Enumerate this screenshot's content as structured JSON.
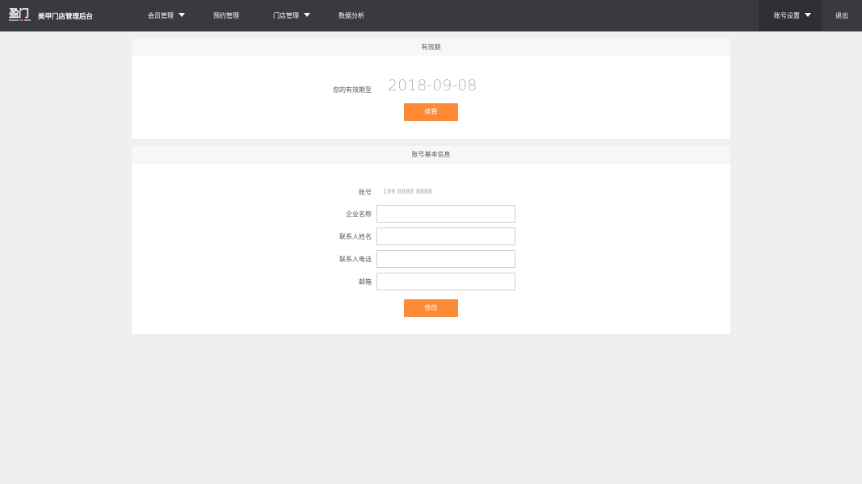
{
  "app": {
    "title": "美甲门店管理后台",
    "logo_text": "盈门"
  },
  "nav": {
    "members": "会员管理",
    "booking": "预约管理",
    "store": "门店管理",
    "analytics": "数据分析",
    "account_settings": "账号设置",
    "logout": "退出"
  },
  "validity": {
    "header": "有效期",
    "label": "您的有效期至",
    "date": "2018-09-08",
    "renew_button": "续费"
  },
  "account_info": {
    "header": "账号基本信息",
    "account_label": "账号",
    "account_value": "189 8888 8888",
    "company_label": "企业名称",
    "company_value": "",
    "contact_name_label": "联系人姓名",
    "contact_name_value": "",
    "contact_phone_label": "联系人电话",
    "contact_phone_value": "",
    "email_label": "邮箱",
    "email_value": "",
    "submit_button": "修改"
  },
  "colors": {
    "topbar": "#383a3f",
    "accent": "#fd8a36",
    "background": "#eeeff1"
  }
}
